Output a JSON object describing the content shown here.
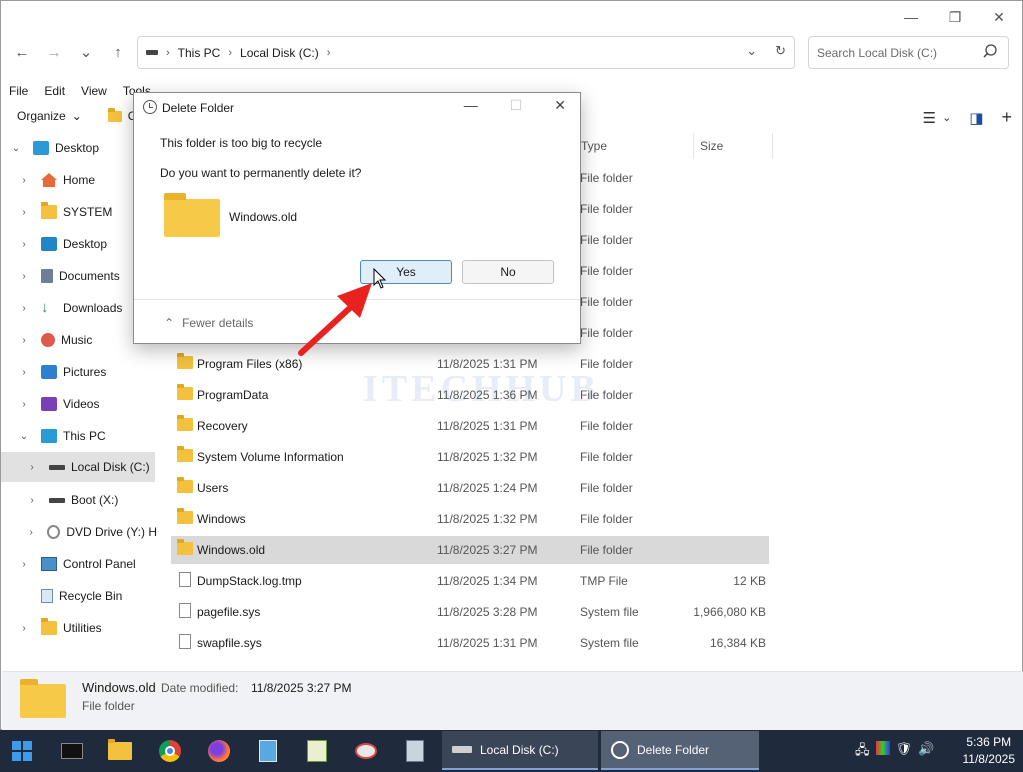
{
  "explorer": {
    "window_controls": {
      "minimize": "—",
      "maximize": "❐",
      "close": "✕"
    },
    "nav_buttons": {
      "back": "←",
      "forward": "→",
      "recent": "⌄",
      "up": "↑"
    },
    "address": {
      "segments": [
        "This PC",
        "Local Disk (C:)"
      ],
      "sep": "›",
      "dropdown": "⌄",
      "refresh": "↻"
    },
    "search": {
      "placeholder": "Search Local Disk (C:)"
    },
    "menu": [
      "File",
      "Edit",
      "View",
      "Tools"
    ],
    "toolbar": {
      "organize_label": "Organize",
      "organize_chev": "⌄",
      "partial_label": "C"
    },
    "toolbar_right": {
      "view": "☰",
      "view_chev": "⌄",
      "pane": "◨",
      "add": "+"
    },
    "nav_pane": [
      {
        "label": "Desktop",
        "exp": "⌄",
        "icon": "desktop-icon"
      },
      {
        "label": "Home",
        "exp": "›",
        "icon": "home-icon"
      },
      {
        "label": "SYSTEM",
        "exp": "›",
        "icon": "folder-icon"
      },
      {
        "label": "Desktop",
        "exp": "›",
        "icon": "desktop-icon"
      },
      {
        "label": "Documents",
        "exp": "›",
        "icon": "documents-icon"
      },
      {
        "label": "Downloads",
        "exp": "›",
        "icon": "downloads-icon"
      },
      {
        "label": "Music",
        "exp": "›",
        "icon": "music-icon"
      },
      {
        "label": "Pictures",
        "exp": "›",
        "icon": "pictures-icon"
      },
      {
        "label": "Videos",
        "exp": "›",
        "icon": "videos-icon"
      },
      {
        "label": "This PC",
        "exp": "⌄",
        "icon": "this-pc-icon"
      },
      {
        "label": "Local Disk (C:)",
        "exp": "›",
        "icon": "drive-icon"
      },
      {
        "label": "Boot (X:)",
        "exp": "›",
        "icon": "drive-icon"
      },
      {
        "label": "DVD Drive (Y:) H",
        "exp": "›",
        "icon": "dvd-icon"
      },
      {
        "label": "Control Panel",
        "exp": "›",
        "icon": "control-panel-icon"
      },
      {
        "label": "Recycle Bin",
        "exp": "",
        "icon": "recycle-bin-icon"
      },
      {
        "label": "Utilities",
        "exp": "›",
        "icon": "folder-icon"
      }
    ],
    "columns": {
      "type": "Type",
      "size": "Size"
    },
    "partial_rows": [
      "File folder",
      "File folder",
      "File folder",
      "File folder",
      "File folder",
      "File folder"
    ],
    "rows": [
      {
        "name": "Program Files (x86)",
        "date": "11/8/2025 1:31 PM",
        "type": "File folder",
        "size": "",
        "kind": "folder"
      },
      {
        "name": "ProgramData",
        "date": "11/8/2025 1:36 PM",
        "type": "File folder",
        "size": "",
        "kind": "folder"
      },
      {
        "name": "Recovery",
        "date": "11/8/2025 1:31 PM",
        "type": "File folder",
        "size": "",
        "kind": "folder"
      },
      {
        "name": "System Volume Information",
        "date": "11/8/2025 1:32 PM",
        "type": "File folder",
        "size": "",
        "kind": "folder"
      },
      {
        "name": "Users",
        "date": "11/8/2025 1:24 PM",
        "type": "File folder",
        "size": "",
        "kind": "folder"
      },
      {
        "name": "Windows",
        "date": "11/8/2025 1:32 PM",
        "type": "File folder",
        "size": "",
        "kind": "folder"
      },
      {
        "name": "Windows.old",
        "date": "11/8/2025 3:27 PM",
        "type": "File folder",
        "size": "",
        "kind": "folder"
      },
      {
        "name": "DumpStack.log.tmp",
        "date": "11/8/2025 1:34 PM",
        "type": "TMP File",
        "size": "12 KB",
        "kind": "file"
      },
      {
        "name": "pagefile.sys",
        "date": "11/8/2025 3:28 PM",
        "type": "System file",
        "size": "1,966,080 KB",
        "kind": "file"
      },
      {
        "name": "swapfile.sys",
        "date": "11/8/2025 1:31 PM",
        "type": "System file",
        "size": "16,384 KB",
        "kind": "file"
      }
    ],
    "watermark": "ITECHHUB",
    "details": {
      "name": "Windows.old",
      "label": "Date modified:",
      "value": "11/8/2025 3:27 PM",
      "type": "File folder"
    }
  },
  "dialog": {
    "title": "Delete Folder",
    "controls": {
      "minimize": "—",
      "maximize": "☐",
      "close": "✕"
    },
    "message1": "This folder is too big to recycle",
    "message2": "Do you want to permanently delete it?",
    "folder_name": "Windows.old",
    "yes_label": "Yes",
    "no_label": "No",
    "fewer_details": "Fewer details",
    "fewer_chev": "⌃"
  },
  "taskbar": {
    "apps": [
      {
        "label": "Local Disk (C:)"
      },
      {
        "label": "Delete Folder"
      }
    ],
    "time": "5:36 PM",
    "date": "11/8/2025"
  },
  "colors": {
    "accent": "#4a8ac9",
    "arrow": "#e8231f",
    "taskbar": "#1f2a3d",
    "folder": "#f3c13d"
  }
}
